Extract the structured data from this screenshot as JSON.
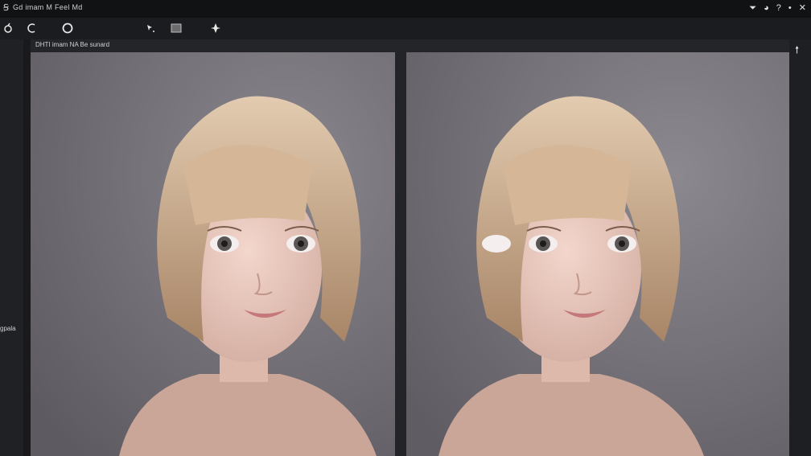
{
  "window": {
    "app_icon": "app-icon",
    "title": "Gd imam M Feel Md"
  },
  "tray": {
    "icons": [
      "filter-icon",
      "user-icon",
      "help-icon",
      "dot-menu-icon",
      "close-icon"
    ]
  },
  "toolbar": {
    "tools": [
      "lasso-tool-icon",
      "undo-icon",
      "circle-select-icon",
      "move-arrow-icon",
      "rectangle-icon",
      "spark-icon"
    ]
  },
  "left_panel": {
    "label": "gpala"
  },
  "document": {
    "title": "DHTI imam NA Be sunard"
  },
  "right_panel": {
    "button": "scroll-up-icon"
  },
  "colors": {
    "background": "#1c1c1e",
    "canvas_bg": "#6f6c72",
    "hair": "#c9ad8e"
  }
}
